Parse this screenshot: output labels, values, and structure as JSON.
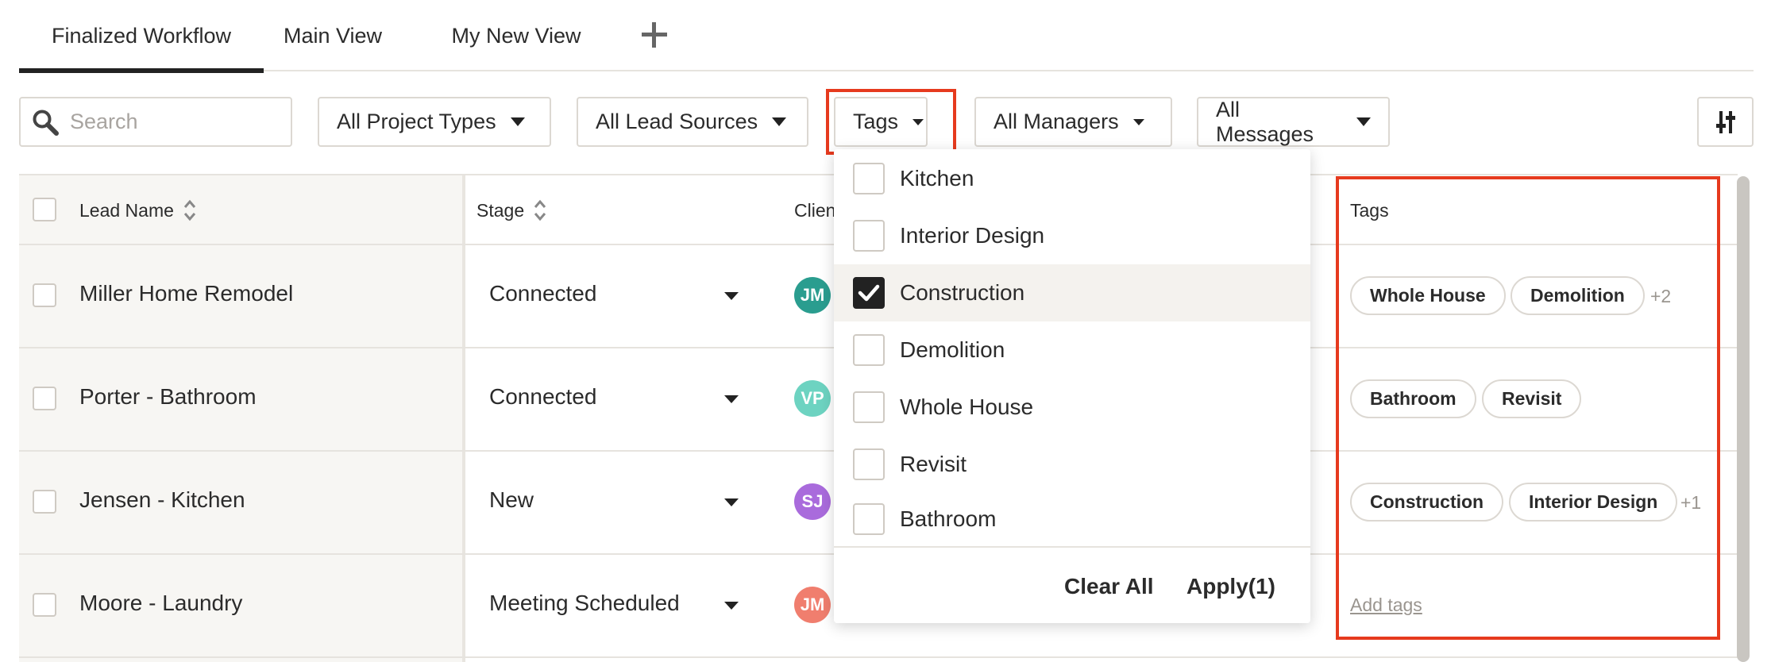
{
  "tabs": [
    {
      "label": "Finalized Workflow",
      "active": true
    },
    {
      "label": "Main View",
      "active": false
    },
    {
      "label": "My New View",
      "active": false
    }
  ],
  "search": {
    "placeholder": "Search",
    "value": ""
  },
  "filters": {
    "project_types": "All Project Types",
    "lead_sources": "All Lead Sources",
    "tags": "Tags",
    "managers": "All Managers",
    "messages": "All Messages"
  },
  "table": {
    "headers": {
      "lead_name": "Lead Name",
      "stage": "Stage",
      "client": "Client",
      "tags": "Tags"
    },
    "rows": [
      {
        "lead_name": "Miller Home Remodel",
        "stage": "Connected",
        "initials": "JM",
        "avatar_color": "#2a9d8f",
        "tags": [
          "Whole House",
          "Demolition"
        ],
        "more": "+2"
      },
      {
        "lead_name": "Porter - Bathroom",
        "stage": "Connected",
        "initials": "VP",
        "avatar_color": "#6dd3c1",
        "tags": [
          "Bathroom",
          "Revisit"
        ],
        "more": ""
      },
      {
        "lead_name": "Jensen - Kitchen",
        "stage": "New",
        "initials": "SJ",
        "avatar_color": "#a96bdc",
        "tags": [
          "Construction",
          "Interior Design"
        ],
        "more": "+1"
      },
      {
        "lead_name": "Moore - Laundry",
        "stage": "Meeting Scheduled",
        "initials": "JM",
        "avatar_color": "#f07e6e",
        "tags": [],
        "more": "",
        "add_tags": "Add tags"
      }
    ]
  },
  "tags_dropdown": {
    "options": [
      {
        "label": "Kitchen",
        "checked": false
      },
      {
        "label": "Interior Design",
        "checked": false
      },
      {
        "label": "Construction",
        "checked": true
      },
      {
        "label": "Demolition",
        "checked": false
      },
      {
        "label": "Whole House",
        "checked": false
      },
      {
        "label": "Revisit",
        "checked": false
      },
      {
        "label": "Bathroom",
        "checked": false
      }
    ],
    "clear_label": "Clear All",
    "apply_label": "Apply(1)"
  },
  "colors": {
    "accent_highlight": "#e63a1e",
    "checkbox_on": "#222222"
  },
  "icons": {
    "search": "search-icon",
    "add_tab": "plus-icon",
    "settings": "sliders-icon",
    "sort": "sort-icon",
    "check": "check-icon"
  }
}
